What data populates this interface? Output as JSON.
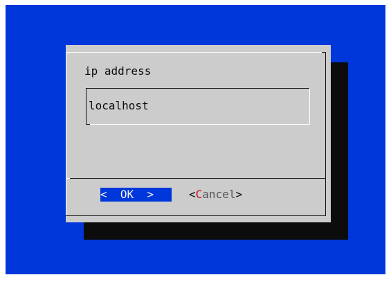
{
  "dialog": {
    "prompt": "ip address",
    "input_value": "localhost"
  },
  "buttons": {
    "ok": {
      "left_bracket": "<",
      "label": "OK",
      "right_bracket": ">"
    },
    "cancel": {
      "left_bracket": "<",
      "hotkey": "C",
      "rest": "ancel",
      "right_bracket": ">"
    }
  },
  "colors": {
    "screen_background": "#0037da",
    "dialog_background": "#cccccc",
    "shadow": "#0c0c0c",
    "selected_button_background": "#0037da",
    "hotkey": "#c50f1f"
  }
}
